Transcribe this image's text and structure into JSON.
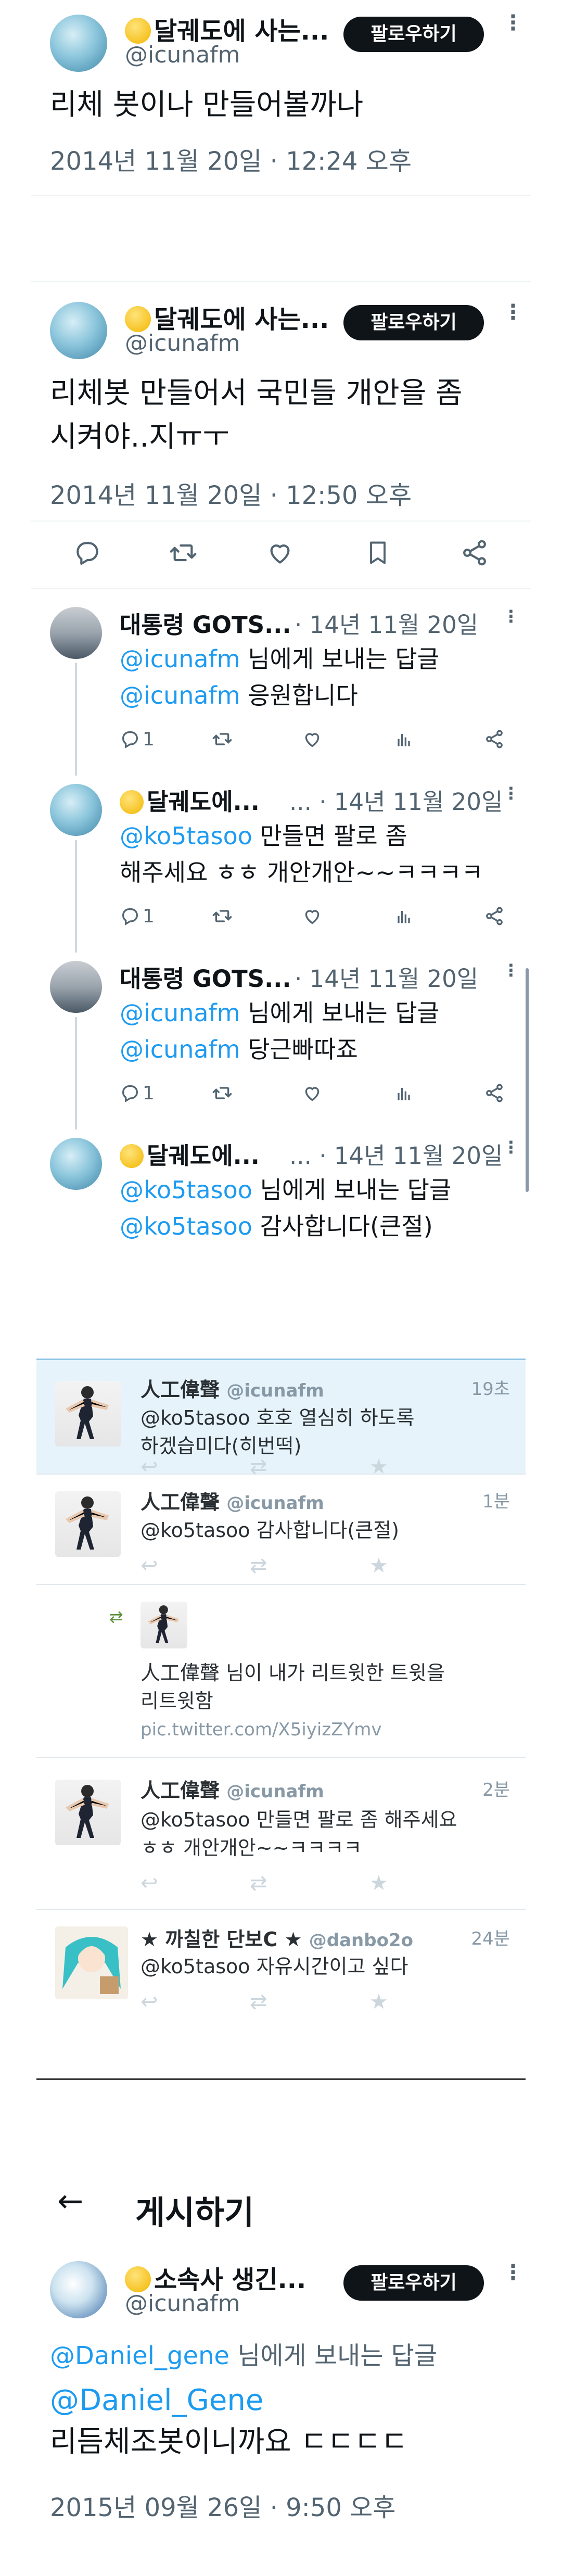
{
  "tweet1": {
    "name": "달궤도에 사는...",
    "handle": "@icunafm",
    "follow": "팔로우하기",
    "text": "리체 봇이나 만들어볼까나",
    "time": "2014년 11월 20일 · 12:24 오후"
  },
  "tweet2": {
    "name": "달궤도에 사는...",
    "handle": "@icunafm",
    "follow": "팔로우하기",
    "text_line1": "리체봇 만들어서 국민들 개안을 좀",
    "text_line2": "시켜야..지ㅠㅜ",
    "time": "2014년 11월 20일 · 12:50 오후"
  },
  "replies": [
    {
      "name": "대통령 GOTS...",
      "meta": "· 14년 11월 20일",
      "line1_link": "@icunafm",
      "line1_rest": " 님에게 보내는 답글",
      "line2_link": "@icunafm",
      "line2_rest": " 응원합니다",
      "reply_count": "1"
    },
    {
      "name": "달궤도에...",
      "meta": "... · 14년 11월 20일",
      "line1_link": "@ko5tasoo",
      "line1_rest": " 만들면 팔로 좀",
      "line2_rest": "해주세요 ㅎㅎ 개안개안~~ㅋㅋㅋㅋ",
      "reply_count": "1"
    },
    {
      "name": "대통령 GOTS...",
      "meta": "· 14년 11월 20일",
      "line1_link": "@icunafm",
      "line1_rest": " 님에게 보내는 답글",
      "line2_link": "@icunafm",
      "line2_rest": " 당근빠따죠",
      "reply_count": "1"
    },
    {
      "name": "달궤도에...",
      "meta": "... · 14년 11월 20일",
      "line1_link": "@ko5tasoo",
      "line1_rest": " 님에게 보내는 답글",
      "line2_link": "@ko5tasoo",
      "line2_rest": " 감사합니다(큰절)"
    }
  ],
  "old_timeline": [
    {
      "name": "人工偉聲",
      "handle": "@icunafm",
      "time": "19초",
      "line1": "@ko5tasoo 호호 열심히 하도록",
      "line2": "하겠습미다(히번떡)"
    },
    {
      "name": "人工偉聲",
      "handle": "@icunafm",
      "time": "1분",
      "line1": "@ko5tasoo 감사합니다(큰절)"
    },
    {
      "line1": "人工偉聲 님이 내가 리트윗한 트윗을",
      "line2": "리트윗함",
      "link": "pic.twitter.com/X5iyizZYmv"
    },
    {
      "name": "人工偉聲",
      "handle": "@icunafm",
      "time": "2분",
      "line1": "@ko5tasoo 만들면 팔로 좀 해주세요",
      "line2": "ㅎㅎ 개안개안~~ㅋㅋㅋㅋ"
    },
    {
      "name": "★ 까칠한 단보C ★",
      "handle": "@danbo2o",
      "time": "24분",
      "line1": "@ko5tasoo 자유시간이고 싶다"
    }
  ],
  "post": {
    "header": "게시하기",
    "name": "소속사 생긴...",
    "handle": "@icunafm",
    "follow": "팔로우하기",
    "reply_to_link": "@Daniel_gene",
    "reply_to_rest": " 님에게 보내는 답글",
    "mention": "@Daniel_Gene",
    "text": "리듬체조봇이니까요 ㄷㄷㄷㄷ",
    "time": "2015년 09월 26일 · 9:50 오후"
  }
}
